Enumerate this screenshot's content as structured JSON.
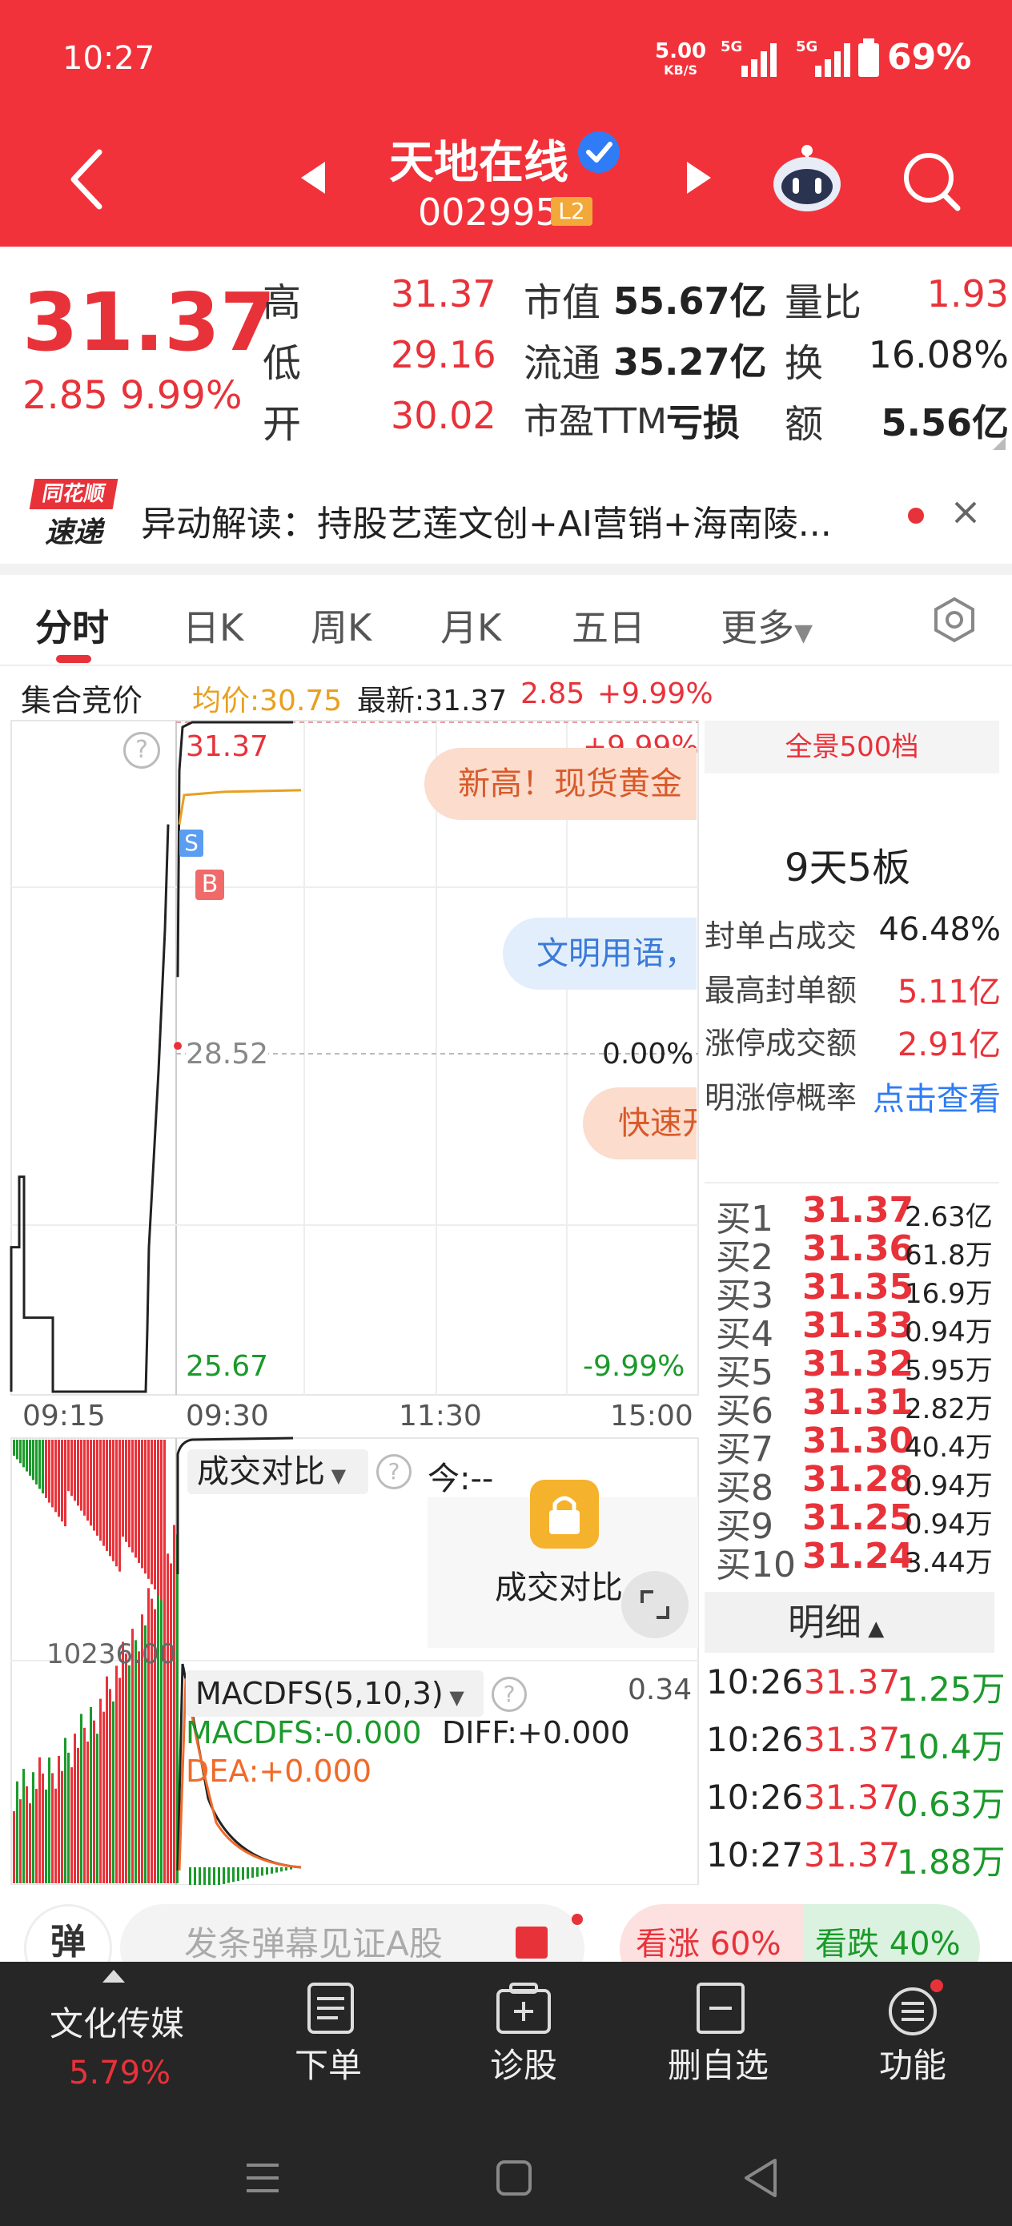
{
  "status": {
    "time": "10:27",
    "net_speed": "5.00",
    "net_unit": "KB/S",
    "sig1": "5G",
    "sig2": "5G",
    "battery": "69%"
  },
  "header": {
    "stock_name": "天地在线",
    "code": "002995",
    "level": "L2"
  },
  "quote": {
    "price": "31.37",
    "change": "2.85",
    "change_pct": "9.99%",
    "high_label": "高",
    "high": "31.37",
    "low_label": "低",
    "low": "29.16",
    "open_label": "开",
    "open": "30.02",
    "mcap_label": "市值",
    "mcap": "55.67亿",
    "float_label": "流通",
    "float": "35.27亿",
    "pe_label": "市盈TTM",
    "pe": "亏损",
    "vr_label": "量比",
    "vr": "1.93",
    "turnover_label": "换",
    "turnover": "16.08%",
    "amount_label": "额",
    "amount": "5.56亿"
  },
  "news": {
    "badge_top": "同花顺",
    "badge_bottom": "速递",
    "text": "异动解读：持股艺莲文创+AI营销+海南陵..."
  },
  "tabs": [
    "分时",
    "日K",
    "周K",
    "月K",
    "五日",
    "更多"
  ],
  "chart_info": {
    "label": "集合竞价",
    "avg": "均价:30.75",
    "latest": "最新:31.37",
    "chg": "2.85",
    "pct": "+9.99%"
  },
  "chart_labels": {
    "top": "31.37",
    "mid": "28.52",
    "bottom": "25.67",
    "top_pct": "+9.99%",
    "mid_pct": "0.00%",
    "bottom_pct": "-9.99%",
    "help": "?"
  },
  "bubbles": {
    "b1": "新高！现货黄金",
    "b2": "文明用语，",
    "b3": "快速开"
  },
  "markers": {
    "s": "S",
    "b": "B"
  },
  "time_axis": [
    "09:15",
    "09:30",
    "11:30",
    "15:00"
  ],
  "chart_data": {
    "type": "line",
    "title": "",
    "ylim": [
      25.67,
      31.37
    ],
    "y_ref": 28.52,
    "x": [
      "09:15",
      "09:30",
      "11:30",
      "15:00"
    ],
    "series": [
      {
        "values": [
          25.67,
          29.2,
          31.37,
          31.37,
          31.37
        ]
      },
      {
        "values": [
          30.75,
          30.75,
          30.75
        ]
      }
    ]
  },
  "volume_panel": {
    "value": "10236.00",
    "compare_label": "成交对比",
    "today": "今:--",
    "compare_button": "成交对比"
  },
  "macd": {
    "label": "MACDFS(5,10,3)",
    "macdfs": "MACDFS:-0.000",
    "diff": "DIFF:+0.000",
    "dea": "DEA:+0.000",
    "value": "0.34"
  },
  "right_panel": {
    "title": "全景500档",
    "streak": "9天5板",
    "rows": [
      {
        "label": "封单占成交",
        "value": "46.48%"
      },
      {
        "label": "最高封单额",
        "value": "5.11亿"
      },
      {
        "label": "涨停成交额",
        "value": "2.91亿"
      },
      {
        "label": "明涨停概率",
        "value": "点击查看"
      }
    ]
  },
  "orderbook": [
    {
      "label": "买1",
      "price": "31.37",
      "vol": "2.63亿"
    },
    {
      "label": "买2",
      "price": "31.36",
      "vol": "61.8万"
    },
    {
      "label": "买3",
      "price": "31.35",
      "vol": "16.9万"
    },
    {
      "label": "买4",
      "price": "31.33",
      "vol": "0.94万"
    },
    {
      "label": "买5",
      "price": "31.32",
      "vol": "5.95万"
    },
    {
      "label": "买6",
      "price": "31.31",
      "vol": "2.82万"
    },
    {
      "label": "买7",
      "price": "31.30",
      "vol": "40.4万"
    },
    {
      "label": "买8",
      "price": "31.28",
      "vol": "0.94万"
    },
    {
      "label": "买9",
      "price": "31.25",
      "vol": "0.94万"
    },
    {
      "label": "买10",
      "price": "31.24",
      "vol": "3.44万"
    }
  ],
  "detail": {
    "title": "明细",
    "rows": [
      {
        "time": "10:26",
        "price": "31.37",
        "vol": "1.25万"
      },
      {
        "time": "10:26",
        "price": "31.37",
        "vol": "10.4万"
      },
      {
        "time": "10:26",
        "price": "31.37",
        "vol": "0.63万"
      },
      {
        "time": "10:27",
        "price": "31.37",
        "vol": "1.88万"
      }
    ]
  },
  "danmu": {
    "icon": "弹",
    "placeholder": "发条弹幕见证A股",
    "up": "看涨 60%",
    "down": "看跌 40%"
  },
  "bottom_nav": {
    "sector": "文化传媒",
    "sector_pct": "5.79%",
    "items": [
      "下单",
      "诊股",
      "删自选",
      "功能"
    ]
  },
  "colors": {
    "brand_red": "#f2323a",
    "up": "#e8323a",
    "down": "#1a9a2a",
    "avg_line": "#e8a020"
  }
}
